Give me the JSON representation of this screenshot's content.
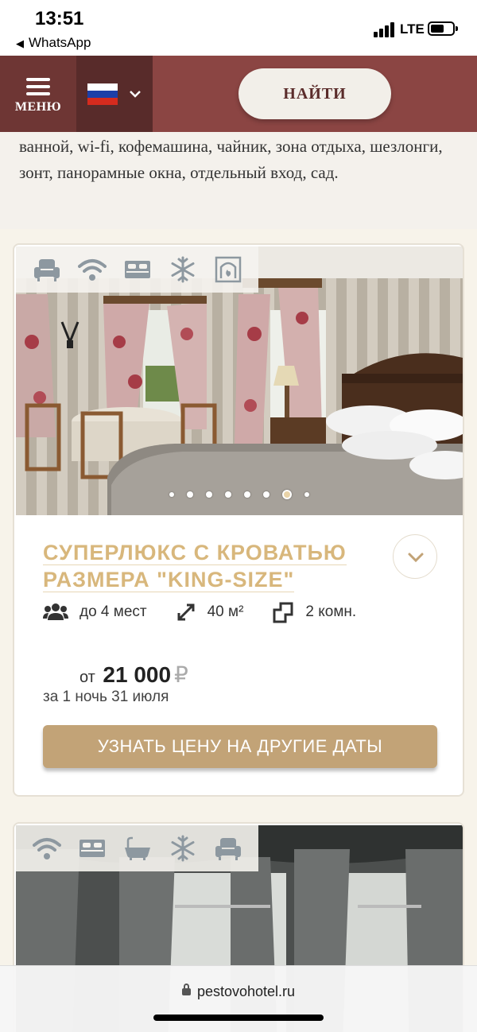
{
  "status_bar": {
    "time": "13:51",
    "back_app": "WhatsApp",
    "network": "LTE"
  },
  "header": {
    "menu_label": "МЕНЮ",
    "language_flag": "russia-flag",
    "find_button": "НАЙТИ"
  },
  "description_text": "ванной, wi-fi, кофемашина, чайник, зона отдыха, шезлонги, зонт, панорамные окна, отдельный вход, сад.",
  "room_card": {
    "amenity_icons": [
      "armchair-icon",
      "wifi-icon",
      "bed-icon",
      "snowflake-icon",
      "fireplace-icon"
    ],
    "carousel": {
      "total": 8,
      "active": 7
    },
    "title": "СУПЕРЛЮКС С КРОВАТЬЮ РАЗМЕРА \"KING-SIZE\"",
    "capacity": "до 4 мест",
    "area": "40 м²",
    "rooms": "2 комн.",
    "price_prefix": "от",
    "price_value": "21 000",
    "currency": "₽",
    "price_note": "за 1 ночь 31 июля",
    "cta": "УЗНАТЬ ЦЕНУ НА ДРУГИЕ ДАТЫ"
  },
  "room_card_2": {
    "amenity_icons": [
      "wifi-icon",
      "bed-icon",
      "bathtub-icon",
      "snowflake-icon",
      "armchair-icon"
    ]
  },
  "browser": {
    "url": "pestovohotel.ru"
  },
  "colors": {
    "header_bg": "#8b4543",
    "menu_bg": "#6e3634",
    "accent_gold": "#d8b77c",
    "cta_bg": "#c2a377"
  }
}
